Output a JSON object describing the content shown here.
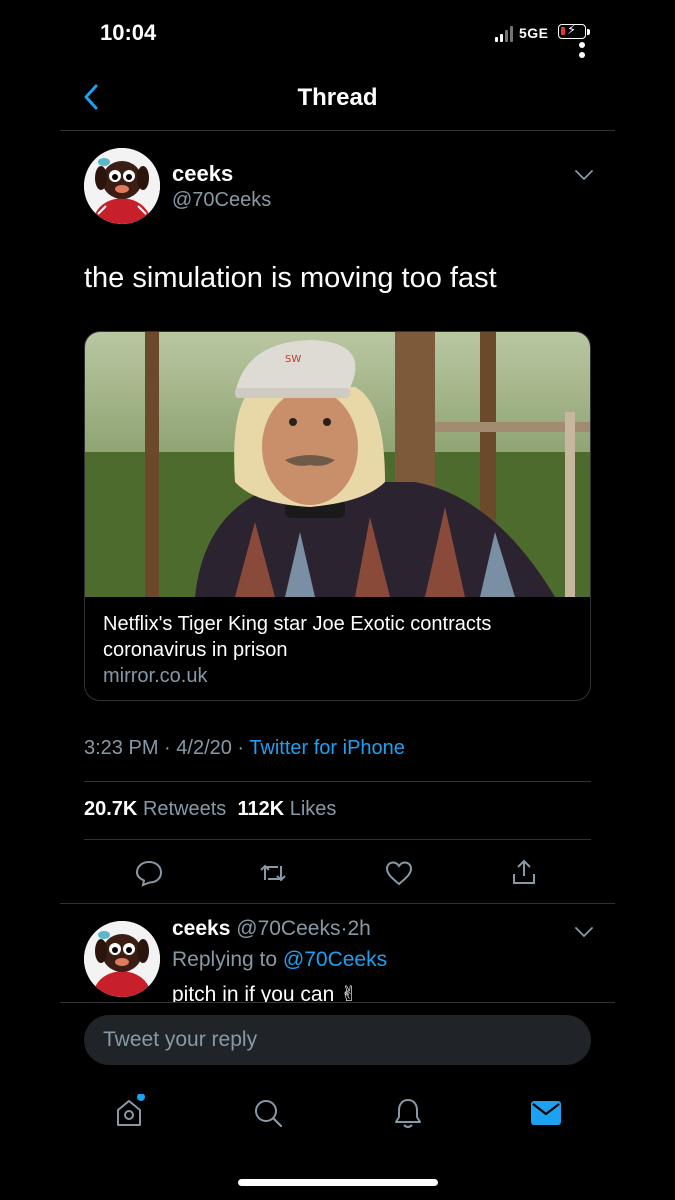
{
  "status_bar": {
    "time": "10:04",
    "network": "5GE"
  },
  "header": {
    "title": "Thread"
  },
  "tweet": {
    "author_name": "ceeks",
    "author_handle": "@70Ceeks",
    "text": "the simulation is moving too fast",
    "card": {
      "title": "Netflix's Tiger King star Joe Exotic contracts coronavirus in prison",
      "domain": "mirror.co.uk"
    },
    "time": "3:23 PM",
    "date": "4/2/20",
    "source": "Twitter for iPhone",
    "retweets_count": "20.7K",
    "retweets_label": "Retweets",
    "likes_count": "112K",
    "likes_label": "Likes"
  },
  "reply": {
    "author_name": "ceeks",
    "author_handle": "@70Ceeks",
    "age": "2h",
    "replying_prefix": "Replying to",
    "replying_handle": "@70Ceeks",
    "text": "pitch in if you can ✌"
  },
  "compose": {
    "placeholder": "Tweet your reply"
  },
  "icons": {
    "back": "chevron-left-icon",
    "more": "chevron-down-icon",
    "reply": "speech-bubble-icon",
    "retweet": "retweet-icon",
    "like": "heart-icon",
    "share": "share-icon",
    "home": "home-icon",
    "search": "search-icon",
    "notifications": "bell-icon",
    "messages": "envelope-icon"
  },
  "colors": {
    "background": "#000000",
    "accent": "#1da1f2",
    "secondary_text": "#8899a6",
    "divider": "#2f3336",
    "battery_low": "#e0392b"
  }
}
